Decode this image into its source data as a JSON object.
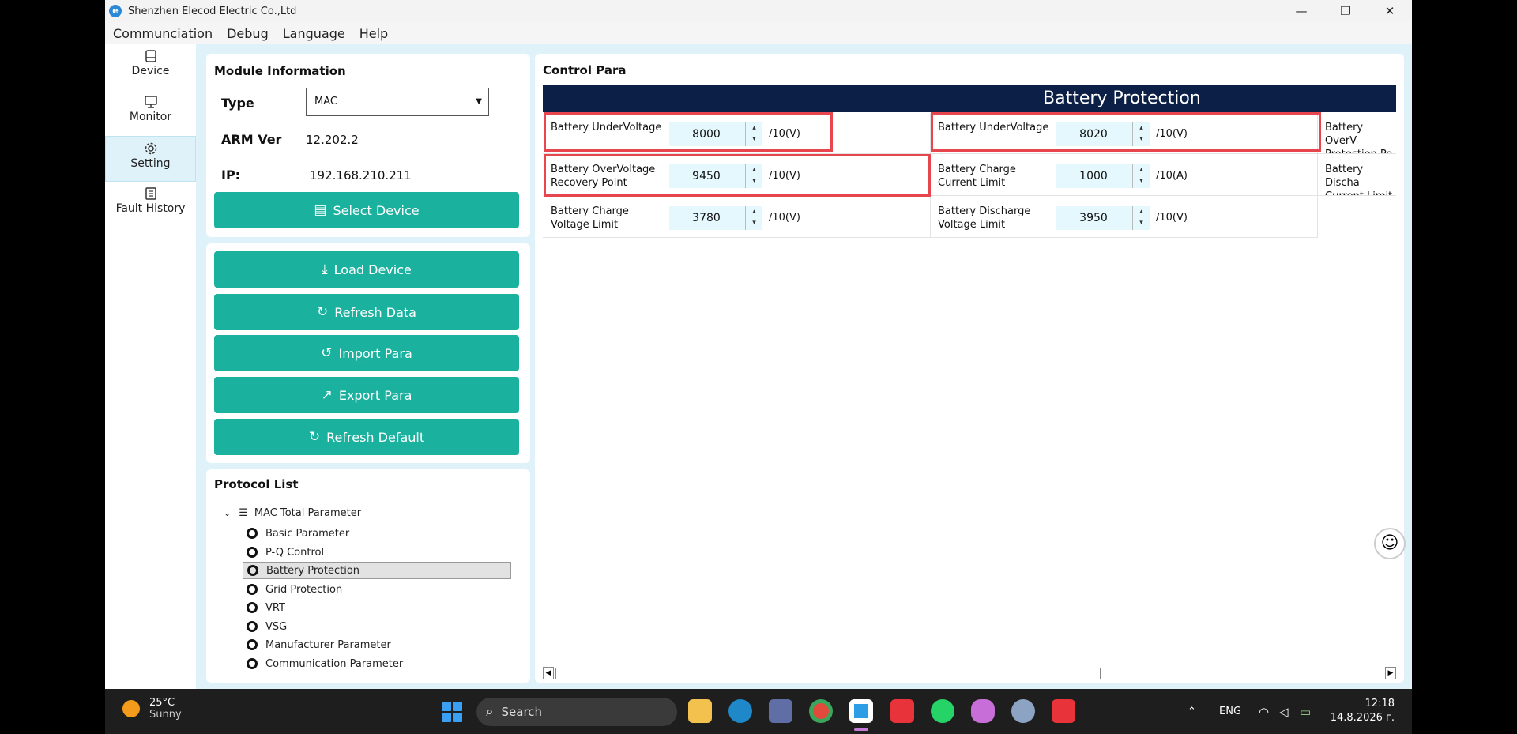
{
  "window": {
    "title": "Shenzhen Elecod Electric Co.,Ltd",
    "minimize": "—",
    "restore": "❐",
    "close": "✕"
  },
  "menu": [
    "Communciation",
    "Debug",
    "Language",
    "Help"
  ],
  "nav": [
    {
      "label": "Device",
      "icon": "hard-drive-icon"
    },
    {
      "label": "Monitor",
      "icon": "monitor-icon"
    },
    {
      "label": "Setting",
      "icon": "gear-icon",
      "active": true
    },
    {
      "label": "Fault History",
      "icon": "document-icon"
    }
  ],
  "module": {
    "title": "Module Information",
    "type_label": "Type",
    "type_value": "MAC",
    "arm_label": "ARM Ver",
    "arm_value": "12.202.2",
    "ip_label": "IP:",
    "ip_value": "192.168.210.211",
    "select_device": "Select Device"
  },
  "actions": {
    "load": "Load Device",
    "refresh_data": "Refresh Data",
    "import": "Import Para",
    "export": "Export Para",
    "refresh_default": "Refresh Default"
  },
  "protocol": {
    "title": "Protocol List",
    "root": "MAC Total Parameter",
    "items": [
      "Basic Parameter",
      "P-Q Control",
      "Battery Protection",
      "Grid Protection",
      "VRT",
      "VSG",
      "Manufacturer Parameter",
      "Communication Parameter"
    ],
    "selected": "Battery Protection"
  },
  "control": {
    "title": "Control Para",
    "header": "Battery Protection",
    "cells": [
      {
        "label": "Battery UnderVoltage",
        "value": "8000",
        "unit": "/10(V)"
      },
      {
        "label": "Battery UnderVoltage",
        "value": "8020",
        "unit": "/10(V)"
      },
      {
        "label": "Battery OverV Protection Po",
        "value": "",
        "unit": ""
      },
      {
        "label": "Battery OverVoltage Recovery Point",
        "value": "9450",
        "unit": "/10(V)"
      },
      {
        "label": "Battery Charge Current Limit",
        "value": "1000",
        "unit": "/10(A)"
      },
      {
        "label": "Battery Discha Current Limit",
        "value": "",
        "unit": ""
      },
      {
        "label": "Battery Charge Voltage Limit",
        "value": "3780",
        "unit": "/10(V)"
      },
      {
        "label": "Battery Discharge Voltage Limit",
        "value": "3950",
        "unit": "/10(V)"
      }
    ]
  },
  "taskbar": {
    "temp": "25°C",
    "weather": "Sunny",
    "search": "Search",
    "lang": "ENG",
    "time": "12:18",
    "date": "14.8.2026 г."
  },
  "colors": {
    "accent": "#1ab19e",
    "header": "#0c1f46",
    "highlight": "#e8464f",
    "background": "#dff2fa"
  }
}
